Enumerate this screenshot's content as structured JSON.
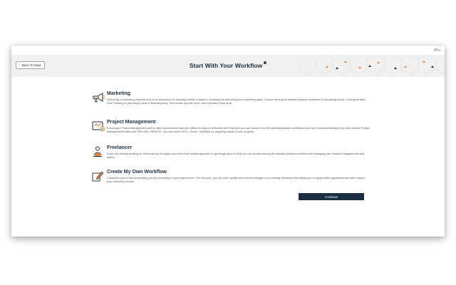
{
  "language": {
    "code": "ZH"
  },
  "header": {
    "back_label": "Back To Main",
    "title": "Start With Your Workflow",
    "info_symbol": "i"
  },
  "options": [
    {
      "name": "Marketing",
      "description": "Delivering in marketing channels and to be productive for handling variety of tasks is necessary for delivering your marketing goals. Choose among the standard phases workflows of Marketing funnel, Lead generation, Goal Tracking or just simply Ideas & Brainstorming. This means you will never miss important thing at all.",
      "icon": "megaphone-icon"
    },
    {
      "name": "Project Management",
      "description": "Following a Project Management path is often cumbersome task and difficult to stay on deliveries with TaskQue you can choose from the standard phases workflows which are recommended/given by International Project management bodies like PMI-USA, PRINCE2. You can select SDLC, Scrum, KANBAN for adjusting variety of your projects.",
      "icon": "project-board-icon"
    },
    {
      "name": "Freelancer",
      "description": "If you are virtually working on clients across the globe you need more simple approach to get things done for that you can choose among the standard phases workflows for managing your freelance assignments and teams.",
      "icon": "freelancer-icon"
    },
    {
      "name": "Create My Own Workflow",
      "description": "Customize your entire productivity journey according to your requirement. The best part, you can even update and commit changes in an existing Workflows this allows you to adjust entire application flow with respect your business process.",
      "icon": "pencil-icon"
    }
  ],
  "continue_label": "Continue",
  "colors": {
    "accent_orange": "#e8843a",
    "navy": "#1c2e44",
    "header_bg": "#f1f1f1"
  }
}
